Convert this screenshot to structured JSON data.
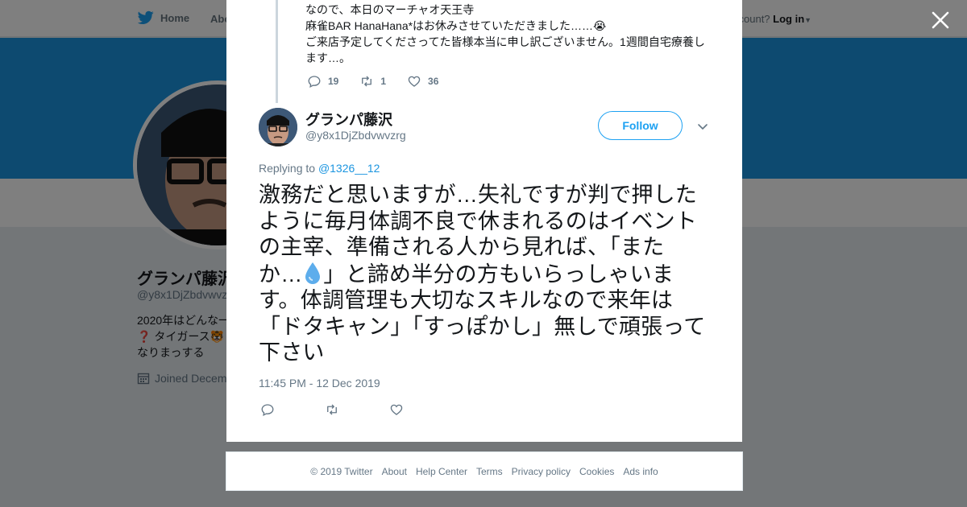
{
  "topbar": {
    "home_label": "Home",
    "about_label": "Abo",
    "login_prompt": "ccount?",
    "login_label": "Log in"
  },
  "background_profile": {
    "name": "グランパ藤沢",
    "handle": "@y8x1DjZbdvwvz",
    "bio_line1": "2020年はどんな一",
    "bio_line2": "❓ タイガース🐯",
    "bio_line3": "なりまっする",
    "joined": "Joined Decem"
  },
  "previous_tweet": {
    "line1": "なので、本日のマーチャオ天王寺",
    "line2": "麻雀BAR HanaHana*はお休みさせていただきました……😭",
    "line3": "ご来店予定してくださってた皆様本当に申し訳ございません。1週間自宅療養し",
    "line4": "ます…。",
    "replies": "19",
    "retweets": "1",
    "likes": "36"
  },
  "tweet": {
    "name": "グランパ藤沢",
    "handle": "@y8x1DjZbdvwvzrg",
    "follow_label": "Follow",
    "replying_prefix": "Replying to",
    "replying_to": "@1326__12",
    "line1": "激務だと思いますが…失礼ですが判で押した",
    "line2": "ように毎月体調不良で休まれるのはイベント",
    "line3": "の主宰、準備される人から見れば、「また",
    "line4a": "か…",
    "line4b": "」と諦め半分の方もいらっしゃいま",
    "line5": "す。体調管理も大切なスキルなので来年は",
    "line6": "「ドタキャン」「すっぽかし」無しで頑張って",
    "line7": "下さい",
    "timestamp": "11:45 PM - 12 Dec 2019"
  },
  "footer": {
    "copyright": "© 2019 Twitter",
    "links": [
      "About",
      "Help Center",
      "Terms",
      "Privacy policy",
      "Cookies",
      "Ads info"
    ]
  },
  "colors": {
    "accent": "#1da1f2",
    "banner": "#1b95e0",
    "secondary_text": "#657786"
  }
}
